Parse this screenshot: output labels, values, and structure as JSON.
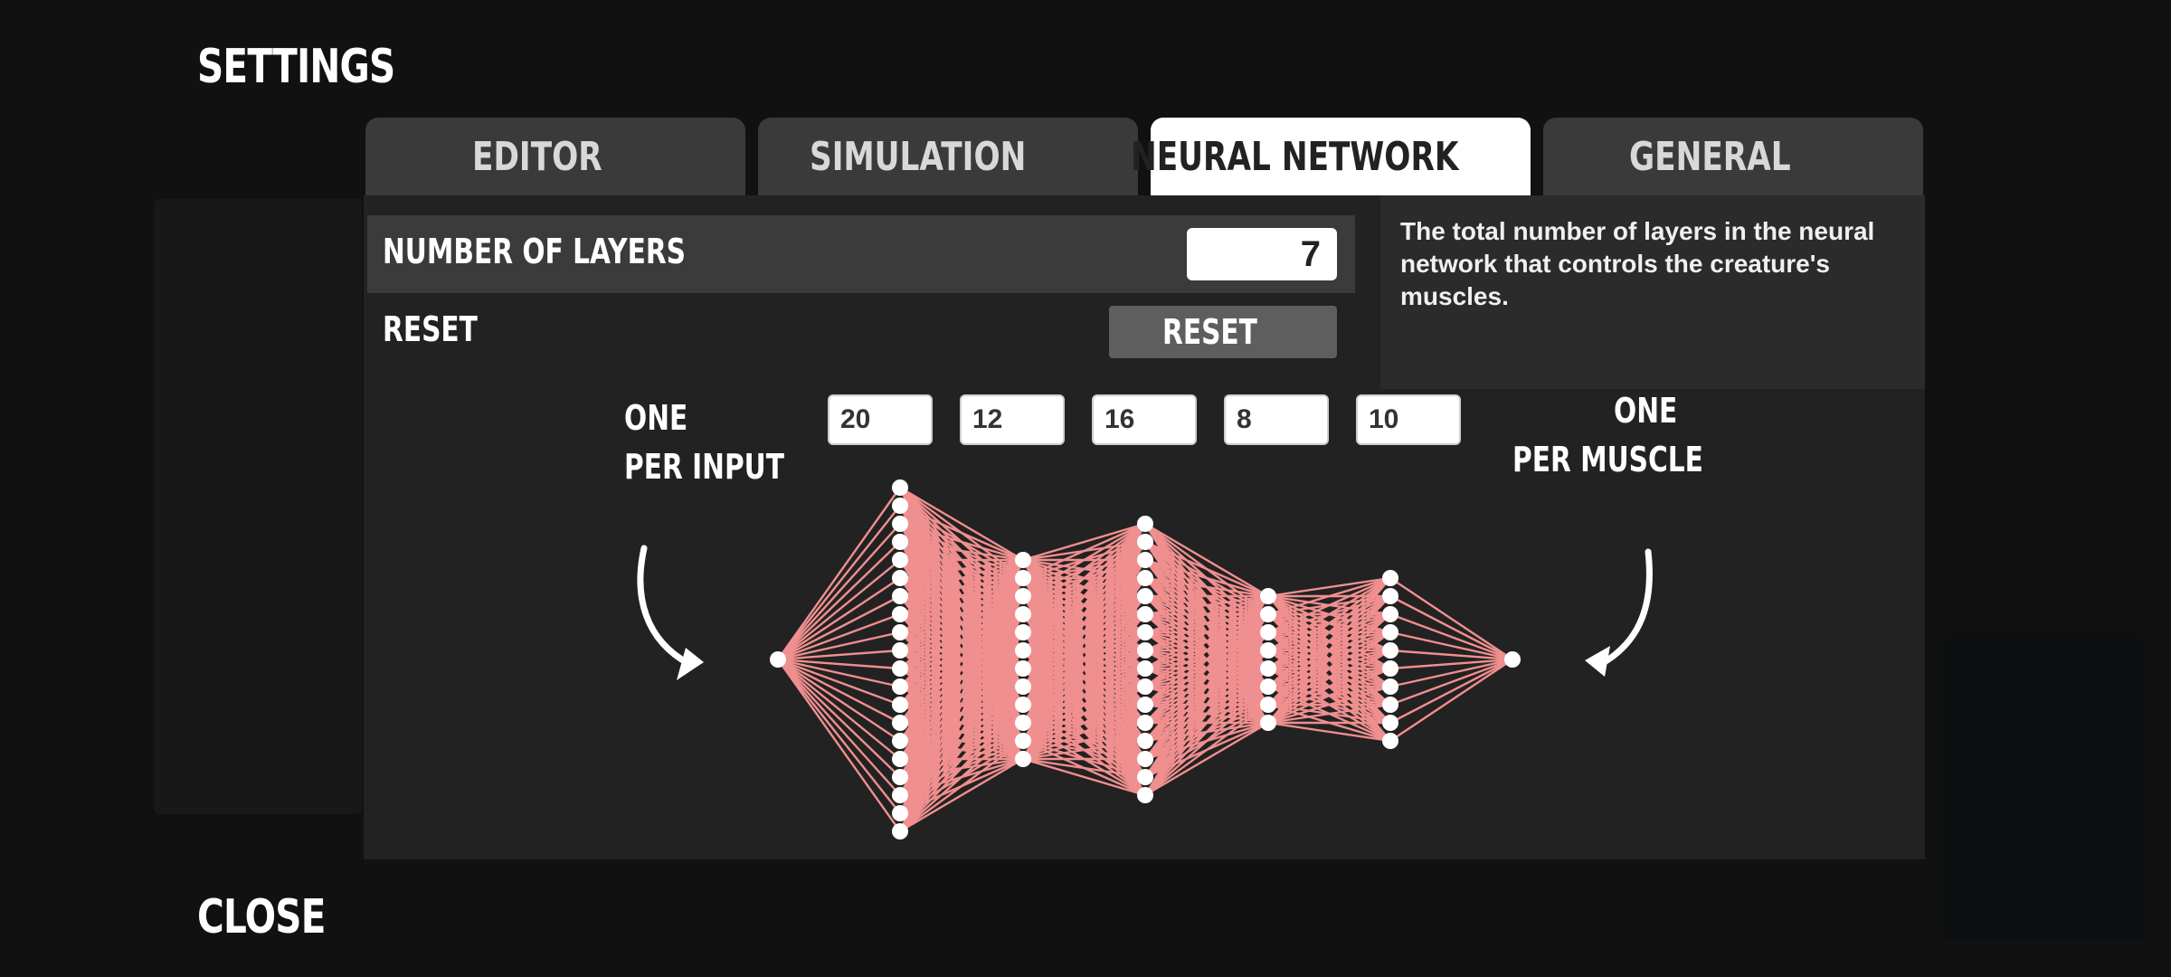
{
  "header": {
    "title": "SETTINGS"
  },
  "footer": {
    "close_label": "CLOSE"
  },
  "tabs": [
    {
      "label": "EDITOR",
      "active": false
    },
    {
      "label": "SIMULATION",
      "active": false
    },
    {
      "label": "NEURAL NETWORK",
      "active": true
    },
    {
      "label": "GENERAL",
      "active": false
    }
  ],
  "settings": {
    "layers_label": "NUMBER OF LAYERS",
    "layers_value": "7",
    "reset_label": "RESET",
    "reset_button": "RESET"
  },
  "tooltip": "The total number of layers in the neural network that controls the creature's muscles.",
  "network": {
    "input_label_line1": "ONE",
    "input_label_line2": "PER INPUT",
    "output_label_line1": "ONE",
    "output_label_line2": "PER MUSCLE",
    "hidden_layer_sizes": [
      "20",
      "12",
      "16",
      "8",
      "10"
    ],
    "layer_node_counts": [
      1,
      20,
      12,
      16,
      8,
      10,
      1
    ]
  },
  "colors": {
    "connection": "#f08f8f",
    "node": "#ffffff",
    "active_tab": "#ffffff",
    "tab": "#3a3a3a",
    "panel": "#222222"
  }
}
